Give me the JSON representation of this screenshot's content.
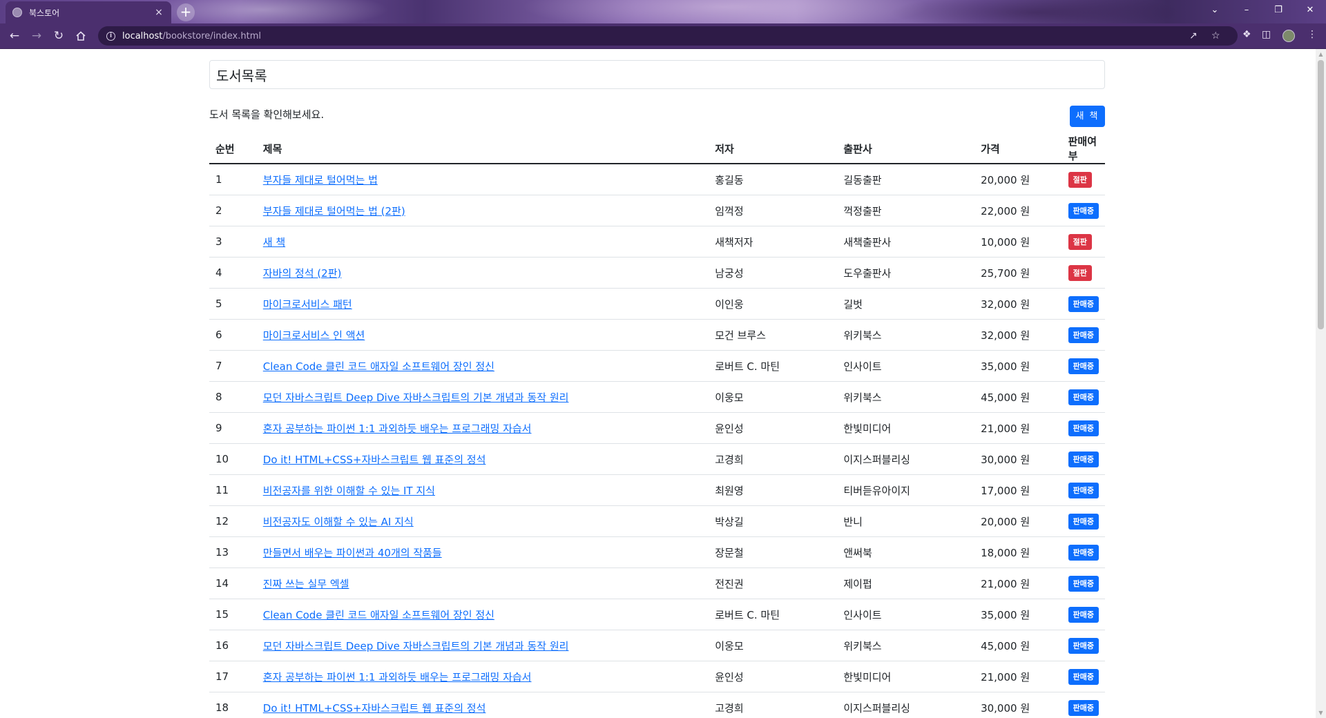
{
  "browser": {
    "tab_title": "북스토어",
    "tab_close": "×",
    "new_tab": "+",
    "url_host": "localhost",
    "url_path": "/bookstore/index.html",
    "window_controls": {
      "dropdown": "⌄",
      "minimize": "–",
      "restore": "❐",
      "close": "✕"
    },
    "icons": [
      "back-arrow-icon",
      "forward-arrow-icon",
      "reload-icon",
      "home-icon",
      "info-icon",
      "share-icon",
      "star-icon",
      "extensions-icon",
      "sidepanel-icon",
      "profile-avatar",
      "menu-dots-icon"
    ]
  },
  "page": {
    "title": "도서목록",
    "description": "도서 목록을 확인해보세요.",
    "new_book_button": "새 책",
    "headers": {
      "no": "순번",
      "title": "제목",
      "author": "저자",
      "publisher": "출판사",
      "price": "가격",
      "status": "판매여부"
    },
    "books": [
      {
        "no": "1",
        "title": "부자들 제대로 털어먹는 법",
        "author": "홍길동",
        "publisher": "길동출판",
        "price": "20,000 원",
        "status": "절판",
        "status_type": "sold"
      },
      {
        "no": "2",
        "title": "부자들 제대로 털어먹는 법 (2판)",
        "author": "임꺽정",
        "publisher": "꺽정출판",
        "price": "22,000 원",
        "status": "판매중",
        "status_type": "sale"
      },
      {
        "no": "3",
        "title": "새 책",
        "author": "새책저자",
        "publisher": "새책출판사",
        "price": "10,000 원",
        "status": "절판",
        "status_type": "sold"
      },
      {
        "no": "4",
        "title": "자바의 정석 (2판)",
        "author": "남궁성",
        "publisher": "도우출판사",
        "price": "25,700 원",
        "status": "절판",
        "status_type": "sold"
      },
      {
        "no": "5",
        "title": "마이크로서비스 패턴",
        "author": "이인웅",
        "publisher": "길벗",
        "price": "32,000 원",
        "status": "판매중",
        "status_type": "sale"
      },
      {
        "no": "6",
        "title": "마이크로서비스 인 액션",
        "author": "모건 브루스",
        "publisher": "위키북스",
        "price": "32,000 원",
        "status": "판매중",
        "status_type": "sale"
      },
      {
        "no": "7",
        "title": "Clean Code 클린 코드 애자일 소프트웨어 장인 정신",
        "author": "로버트 C. 마틴",
        "publisher": "인사이트",
        "price": "35,000 원",
        "status": "판매중",
        "status_type": "sale"
      },
      {
        "no": "8",
        "title": "모던 자바스크립트 Deep Dive 자바스크립트의 기본 개념과 동작 원리",
        "author": "이웅모",
        "publisher": "위키북스",
        "price": "45,000 원",
        "status": "판매중",
        "status_type": "sale"
      },
      {
        "no": "9",
        "title": "혼자 공부하는 파이썬 1:1 과외하듯 배우는 프로그래밍 자습서",
        "author": "윤인성",
        "publisher": "한빛미디어",
        "price": "21,000 원",
        "status": "판매중",
        "status_type": "sale"
      },
      {
        "no": "10",
        "title": "Do it! HTML+CSS+자바스크립트 웹 표준의 정석",
        "author": "고경희",
        "publisher": "이지스퍼블리싱",
        "price": "30,000 원",
        "status": "판매중",
        "status_type": "sale"
      },
      {
        "no": "11",
        "title": "비전공자를 위한 이해할 수 있는 IT 지식",
        "author": "최원영",
        "publisher": "티버듣유아이지",
        "price": "17,000 원",
        "status": "판매중",
        "status_type": "sale"
      },
      {
        "no": "12",
        "title": "비전공자도 이해할 수 있는 AI 지식",
        "author": "박상길",
        "publisher": "반니",
        "price": "20,000 원",
        "status": "판매중",
        "status_type": "sale"
      },
      {
        "no": "13",
        "title": "만들면서 배우는 파이썬과 40개의 작품들",
        "author": "장문철",
        "publisher": "앤써북",
        "price": "18,000 원",
        "status": "판매중",
        "status_type": "sale"
      },
      {
        "no": "14",
        "title": "진짜 쓰는 실무 엑셀",
        "author": "전진권",
        "publisher": "제이펍",
        "price": "21,000 원",
        "status": "판매중",
        "status_type": "sale"
      },
      {
        "no": "15",
        "title": "Clean Code 클린 코드 애자일 소프트웨어 장인 정신",
        "author": "로버트 C. 마틴",
        "publisher": "인사이트",
        "price": "35,000 원",
        "status": "판매중",
        "status_type": "sale"
      },
      {
        "no": "16",
        "title": "모던 자바스크립트 Deep Dive 자바스크립트의 기본 개념과 동작 원리",
        "author": "이웅모",
        "publisher": "위키북스",
        "price": "45,000 원",
        "status": "판매중",
        "status_type": "sale"
      },
      {
        "no": "17",
        "title": "혼자 공부하는 파이썬 1:1 과외하듯 배우는 프로그래밍 자습서",
        "author": "윤인성",
        "publisher": "한빛미디어",
        "price": "21,000 원",
        "status": "판매중",
        "status_type": "sale"
      },
      {
        "no": "18",
        "title": "Do it! HTML+CSS+자바스크립트 웹 표준의 정석",
        "author": "고경희",
        "publisher": "이지스퍼블리싱",
        "price": "30,000 원",
        "status": "판매중",
        "status_type": "sale"
      }
    ]
  },
  "colors": {
    "primary": "#0d6efd",
    "danger": "#dc3545",
    "chrome": "#4b2f6e"
  }
}
